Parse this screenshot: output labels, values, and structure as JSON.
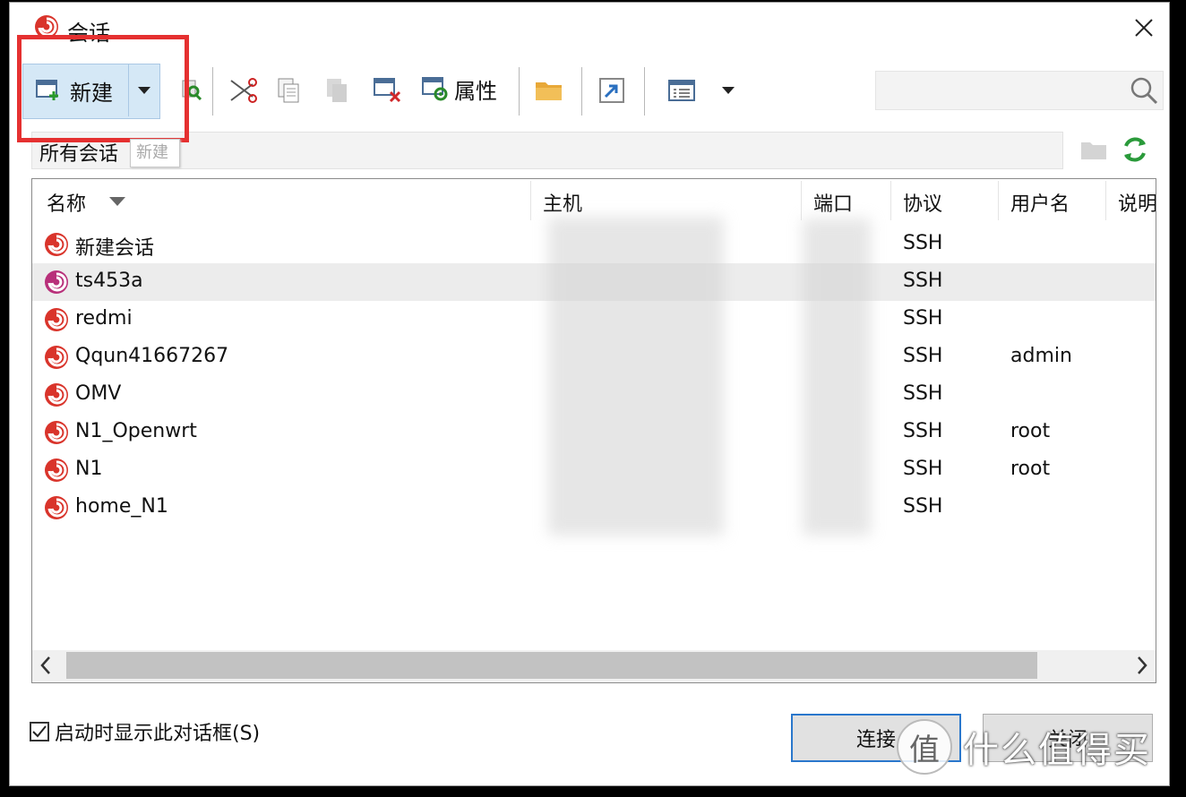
{
  "window": {
    "title": "会话"
  },
  "toolbar": {
    "new_label": "新建",
    "properties_label": "属性",
    "tooltip": "新建",
    "search_placeholder": ""
  },
  "path": {
    "current": "所有会话"
  },
  "columns": {
    "name": "名称",
    "host": "主机",
    "port": "端口",
    "protocol": "协议",
    "username": "用户名",
    "description": "说明"
  },
  "sessions": [
    {
      "name": "新建会话",
      "protocol": "SSH",
      "username": ""
    },
    {
      "name": "ts453a",
      "protocol": "SSH",
      "username": ""
    },
    {
      "name": "redmi",
      "protocol": "SSH",
      "username": ""
    },
    {
      "name": "Qqun41667267",
      "protocol": "SSH",
      "username": "admin"
    },
    {
      "name": "OMV",
      "protocol": "SSH",
      "username": ""
    },
    {
      "name": "N1_Openwrt",
      "protocol": "SSH",
      "username": "root"
    },
    {
      "name": "N1",
      "protocol": "SSH",
      "username": "root"
    },
    {
      "name": "home_N1",
      "protocol": "SSH",
      "username": ""
    }
  ],
  "footer": {
    "startup_checkbox_label": "启动时显示此对话框(S)",
    "startup_checked": true,
    "connect_label": "连接",
    "close_label": "关闭"
  },
  "watermark": {
    "text": "什么值得买",
    "logo": "值"
  },
  "colors": {
    "highlight_border": "#e53030",
    "xshell_red": "#d9342b",
    "selection": "#ececec"
  }
}
